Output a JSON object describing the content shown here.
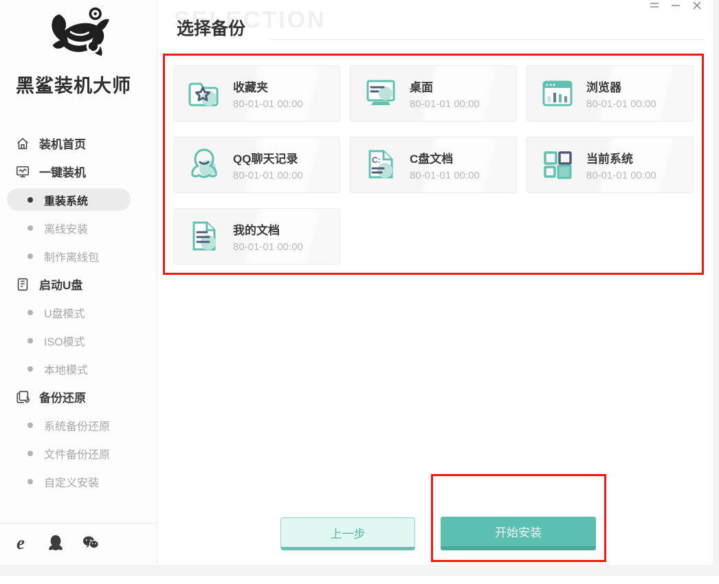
{
  "window": {
    "controls": [
      {
        "icon": "menu-icon"
      },
      {
        "icon": "minimize-icon"
      },
      {
        "icon": "close-icon"
      }
    ]
  },
  "sidebar": {
    "brand": "黑鲨装机大师",
    "menu": [
      {
        "label": "装机首页",
        "type": "top",
        "icon": "home-icon"
      },
      {
        "label": "一键装机",
        "type": "top",
        "icon": "monitor-icon"
      },
      {
        "label": "重装系统",
        "type": "sub",
        "active": true
      },
      {
        "label": "离线安装",
        "type": "sub",
        "active": false
      },
      {
        "label": "制作离线包",
        "type": "sub",
        "active": false
      },
      {
        "label": "启动U盘",
        "type": "top",
        "icon": "usb-drive-icon"
      },
      {
        "label": "U盘模式",
        "type": "sub",
        "active": false
      },
      {
        "label": "ISO模式",
        "type": "sub",
        "active": false
      },
      {
        "label": "本地模式",
        "type": "sub",
        "active": false
      },
      {
        "label": "备份还原",
        "type": "top",
        "icon": "backup-restore-icon"
      },
      {
        "label": "系统备份还原",
        "type": "sub",
        "active": false
      },
      {
        "label": "文件备份还原",
        "type": "sub",
        "active": false
      },
      {
        "label": "自定义安装",
        "type": "sub",
        "active": false
      }
    ],
    "footer_icons": [
      "ie-icon",
      "qq-icon",
      "wechat-icon"
    ]
  },
  "main": {
    "watermark": "SELECTION",
    "title": "选择备份",
    "cards": [
      {
        "label": "收藏夹",
        "date": "80-01-01 00:00",
        "icon": "folder-star-icon"
      },
      {
        "label": "桌面",
        "date": "80-01-01 00:00",
        "icon": "desktop-icon"
      },
      {
        "label": "浏览器",
        "date": "80-01-01 00:00",
        "icon": "browser-icon"
      },
      {
        "label": "QQ聊天记录",
        "date": "80-01-01 00:00",
        "icon": "qq-penguin-icon"
      },
      {
        "label": "C盘文档",
        "date": "80-01-01 00:00",
        "icon": "c-drive-document-icon",
        "icon_text": "C:"
      },
      {
        "label": "当前系统",
        "date": "80-01-01 00:00",
        "icon": "current-system-icon"
      },
      {
        "label": "我的文档",
        "date": "80-01-01 00:00",
        "icon": "my-documents-icon"
      }
    ],
    "buttons": {
      "previous": "上一步",
      "start": "开始安装"
    }
  },
  "colors": {
    "accent_teal": "#5ec1b1",
    "teal_light_fill": "#bce4db",
    "navy_accent": "#505a7a",
    "annotation_red": "#f5190d",
    "active_pill_bg": "#ececec"
  }
}
